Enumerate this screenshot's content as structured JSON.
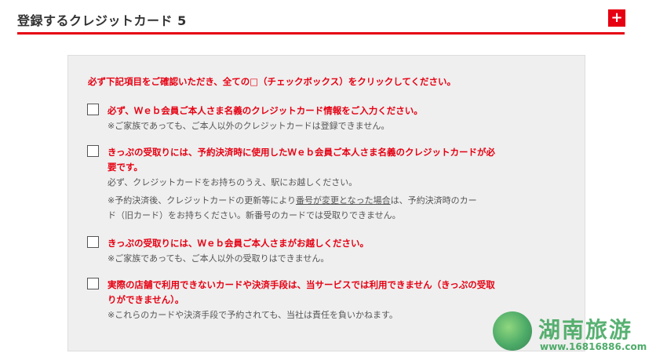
{
  "header": {
    "title": "登録するクレジットカード 5",
    "add_label": "+"
  },
  "intro": "必ず下記項目をご確認いただき、全ての□（チェックボックス）をクリックしてください。",
  "items": [
    {
      "heading": "必ず、Ｗｅｂ会員ご本人さま名義のクレジットカード情報をご入力ください。",
      "note": "※ご家族であっても、ご本人以外のクレジットカードは登録できません。"
    },
    {
      "heading_line1": "きっぷの受取りには、予約決済時に使用したＷｅｂ会員ご本人さま名義のクレジットカードが必",
      "heading_line2": "要です。",
      "note": "必ず、クレジットカードをお持ちのうえ、駅にお越しください。",
      "note2_pre": "※予約決済後、クレジットカードの更新等により",
      "note2_link": "番号が変更となった場合",
      "note2_post": "は、予約決済時のカー",
      "note2_line2": "ド（旧カード）をお持ちください。新番号のカードでは受取りできません。"
    },
    {
      "heading": "きっぷの受取りには、Ｗｅｂ会員ご本人さまがお越しください。",
      "note": "※ご家族であっても、ご本人以外の受取りはできません。"
    },
    {
      "heading_line1": "実際の店舗で利用できないカードや決済手段は、当サービスでは利用できません（きっぷの受取",
      "heading_line2": "りができません）。",
      "note": "※これらのカードや決済手段で予約されても、当社は責任を負いかねます。"
    }
  ],
  "watermark": {
    "brand": "湖南旅游",
    "url": "www.16816886.com"
  },
  "colors": {
    "accent": "#e60012",
    "panel": "#efefef"
  }
}
